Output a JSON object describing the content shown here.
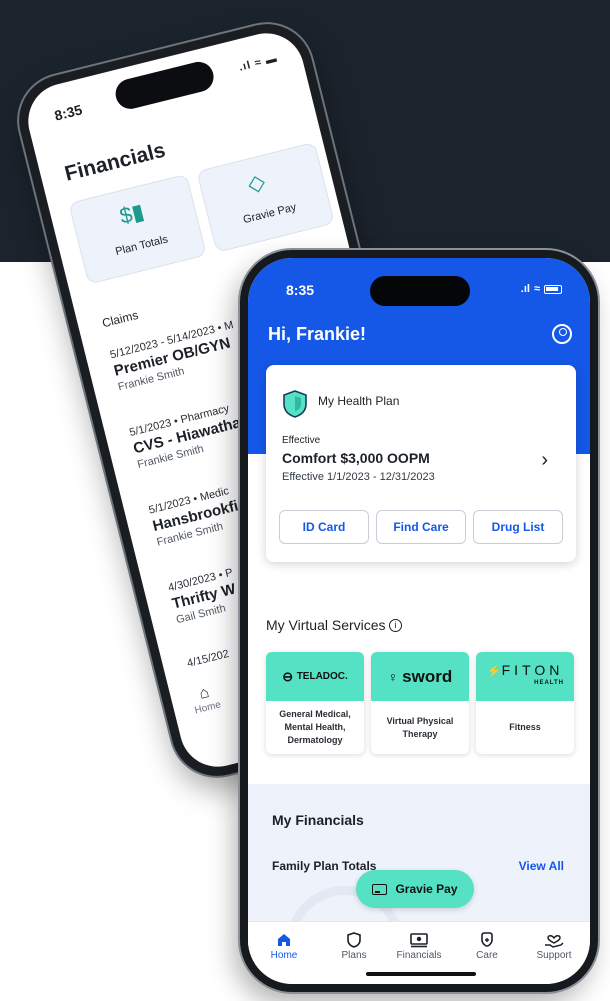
{
  "back_phone": {
    "time": "8:35",
    "title": "Financials",
    "tiles": [
      {
        "label": "Plan Totals",
        "icon": "plan-totals-icon"
      },
      {
        "label": "Gravie Pay",
        "icon": "gravie-pay-icon"
      }
    ],
    "claims_label": "Claims",
    "claims": [
      {
        "meta": "5/12/2023 - 5/14/2023 • M",
        "name": "Premier OB/GYN",
        "person": "Frankie Smith"
      },
      {
        "meta": "5/1/2023 • Pharmacy",
        "name": "CVS - Hiawatha",
        "person": "Frankie Smith"
      },
      {
        "meta": "5/1/2023 • Medic",
        "name": "Hansbrookfie",
        "person": "Frankie Smith"
      },
      {
        "meta": "4/30/2023 • P",
        "name": "Thrifty W",
        "person": "Gail Smith"
      },
      {
        "meta": "4/15/202",
        "name": "",
        "person": ""
      }
    ],
    "home_label": "Home"
  },
  "status": {
    "time": "8:35"
  },
  "header": {
    "greeting": "Hi, Frankie!"
  },
  "plan_card": {
    "title": "My Health Plan",
    "effective_label": "Effective",
    "plan_name": "Comfort $3,000 OOPM",
    "dates": "Effective 1/1/2023 - 12/31/2023",
    "buttons": [
      "ID Card",
      "Find Care",
      "Drug List"
    ]
  },
  "virtual_services": {
    "title": "My Virtual Services",
    "cards": [
      {
        "brand": "TELADOC.",
        "description": "General Medical, Mental Health, Dermatology"
      },
      {
        "brand": "sword",
        "description": "Virtual Physical Therapy"
      },
      {
        "brand": "FITON",
        "brand_sub": "HEALTH",
        "description": "Fitness"
      }
    ]
  },
  "financials": {
    "title": "My Financials",
    "family_label": "Family Plan Totals",
    "view_all": "View All"
  },
  "gravie_pay_button": "Gravie Pay",
  "tabs": [
    {
      "label": "Home",
      "icon": "home-icon",
      "active": true
    },
    {
      "label": "Plans",
      "icon": "shield-icon"
    },
    {
      "label": "Financials",
      "icon": "money-icon"
    },
    {
      "label": "Care",
      "icon": "care-icon"
    },
    {
      "label": "Support",
      "icon": "support-icon"
    }
  ],
  "colors": {
    "primary": "#1558e8",
    "accent": "#54e1c4",
    "background_dark": "#1b232c"
  }
}
